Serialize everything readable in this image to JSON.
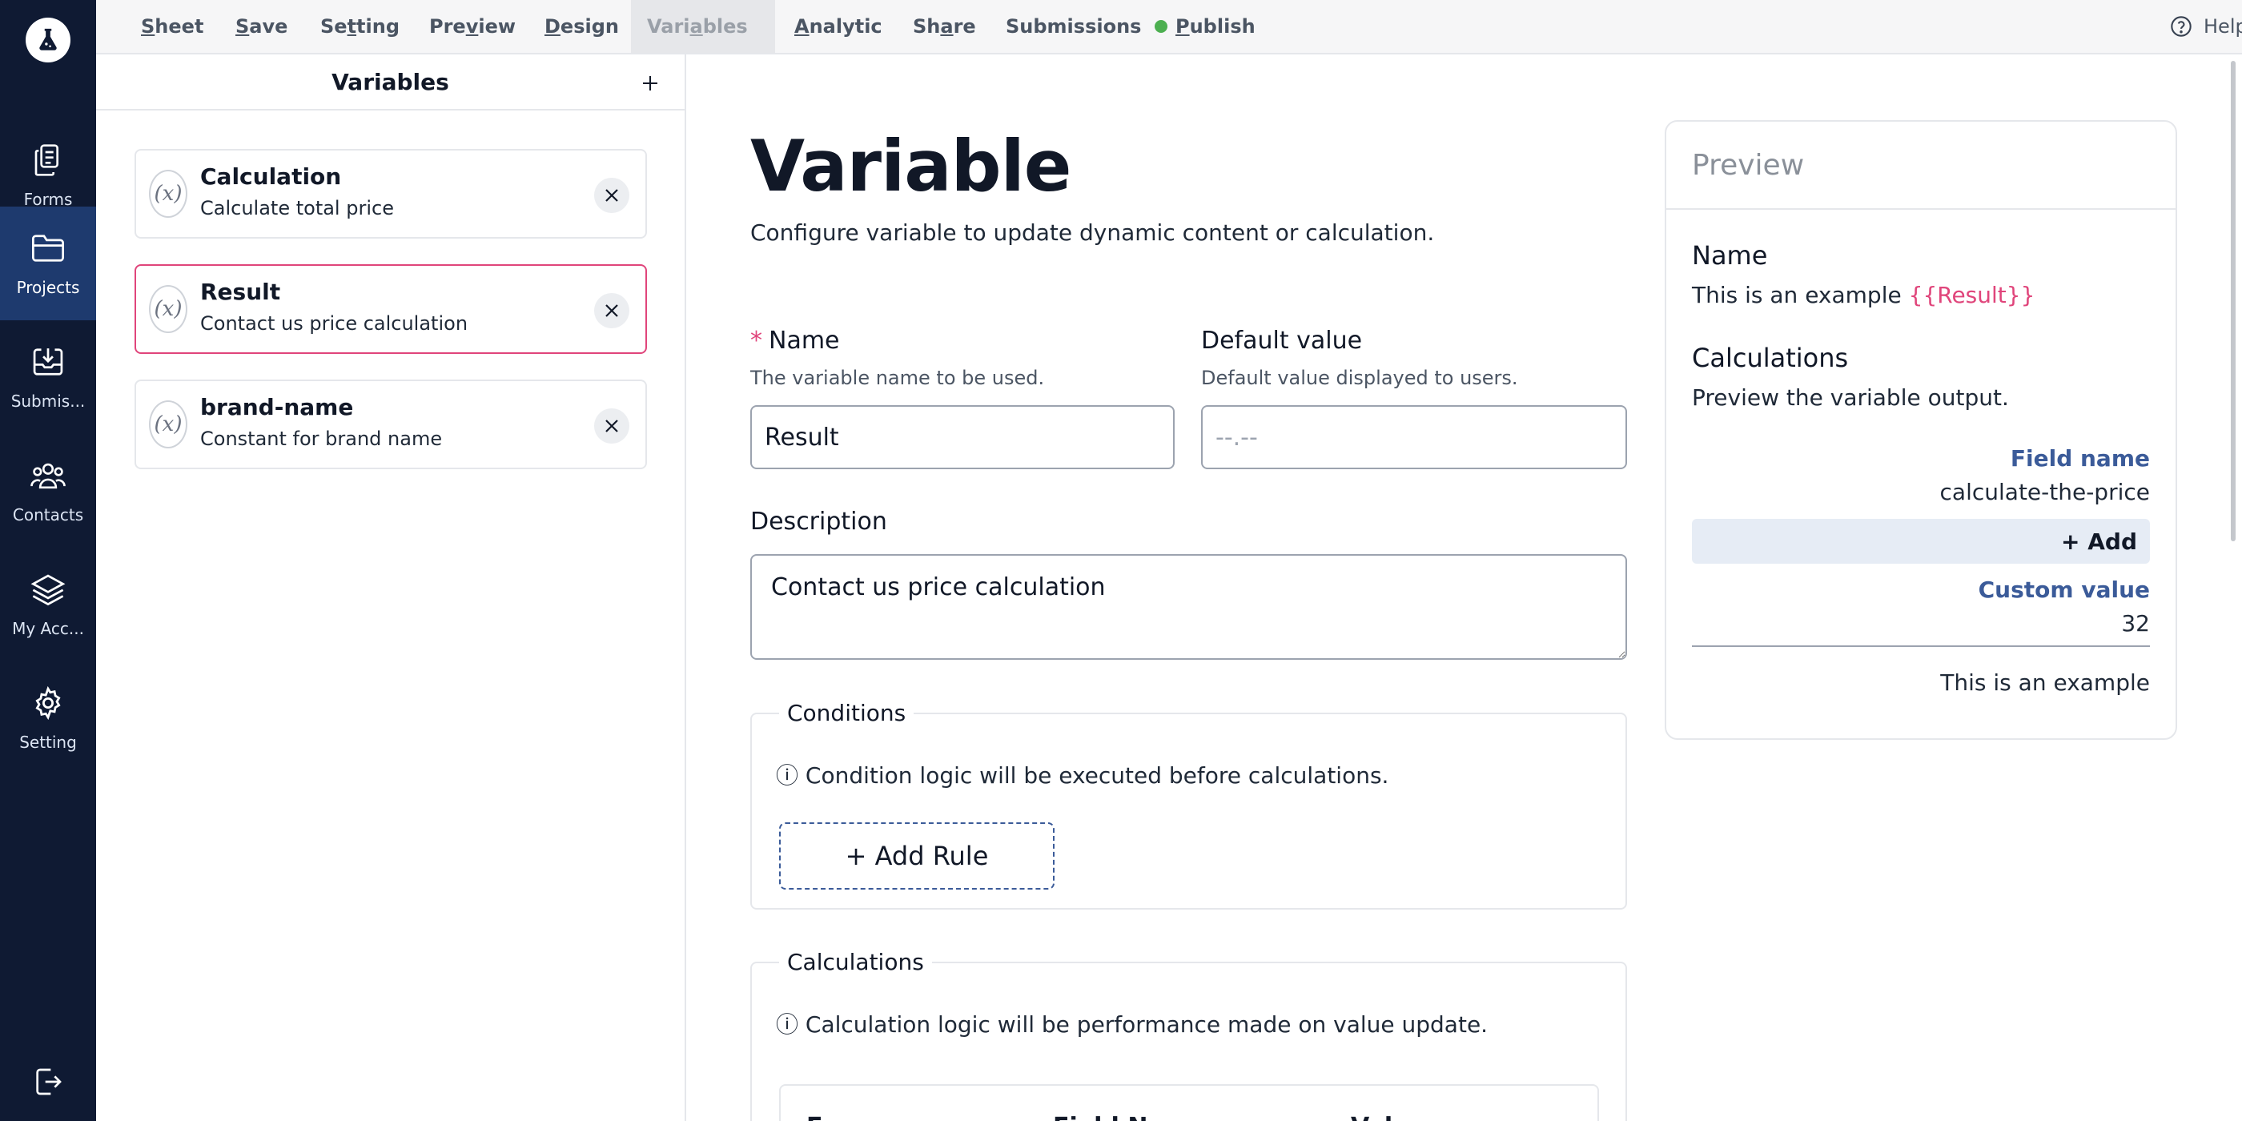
{
  "rail": {
    "items": [
      {
        "label": "Forms",
        "icon": "forms-icon"
      },
      {
        "label": "Projects",
        "icon": "folder-icon"
      },
      {
        "label": "Submis...",
        "icon": "inbox-icon"
      },
      {
        "label": "Contacts",
        "icon": "contacts-icon"
      },
      {
        "label": "My Acc...",
        "icon": "layers-icon"
      },
      {
        "label": "Setting",
        "icon": "gear-icon"
      }
    ],
    "active": "Projects"
  },
  "topnav": {
    "items": [
      {
        "pre": "",
        "u": "S",
        "post": "heet"
      },
      {
        "pre": "",
        "u": "S",
        "post": "ave"
      },
      {
        "pre": "Se",
        "u": "t",
        "post": "ting"
      },
      {
        "pre": "Pre",
        "u": "v",
        "post": "iew"
      },
      {
        "pre": "",
        "u": "D",
        "post": "esign"
      },
      {
        "pre": "Vari",
        "u": "a",
        "post": "bles"
      },
      {
        "pre": "",
        "u": "A",
        "post": "nalytic"
      },
      {
        "pre": "Sh",
        "u": "a",
        "post": "re"
      },
      {
        "pre": "Submissions",
        "u": "",
        "post": ""
      },
      {
        "pre": "",
        "u": "P",
        "post": "ublish"
      }
    ],
    "active": "Variables",
    "publish_status_color": "#4caf50",
    "help_label": "Help"
  },
  "variables_panel": {
    "title": "Variables",
    "items": [
      {
        "name": "Calculation",
        "description": "Calculate total price",
        "icon_text": "(x)"
      },
      {
        "name": "Result",
        "description": "Contact us price calculation",
        "icon_text": "(x)"
      },
      {
        "name": "brand-name",
        "description": "Constant for brand name",
        "icon_text": "(x)"
      }
    ],
    "selected": "Result",
    "selected_color": "#e0457b"
  },
  "form": {
    "title": "Variable",
    "subtitle": "Configure variable to update dynamic content or calculation.",
    "name": {
      "required_mark": "*",
      "label": "Name",
      "hint": "The variable name to be used.",
      "value": "Result"
    },
    "default_value": {
      "label": "Default value",
      "hint": "Default value displayed to users.",
      "placeholder": "--.--"
    },
    "description": {
      "label": "Description",
      "value": "Contact us price calculation"
    },
    "conditions": {
      "legend": "Conditions",
      "info": "ⓘ Condition logic will be executed before calculations.",
      "add_rule_label": "+ Add Rule"
    },
    "calculations": {
      "legend": "Calculations",
      "info": "ⓘ Calculation logic will be performance made on value update.",
      "columns": [
        "Form",
        "Field Name",
        "Value"
      ]
    }
  },
  "preview": {
    "title": "Preview",
    "name_heading": "Name",
    "example_text": "This is an example",
    "example_var": "{{Result}}",
    "calc_heading": "Calculations",
    "calc_sub": "Preview the variable output.",
    "field_name_label": "Field name",
    "field_name_value": "calculate-the-price",
    "add_label": "+ Add",
    "custom_value_label": "Custom value",
    "custom_value": "32",
    "output_text": "This is an example"
  }
}
